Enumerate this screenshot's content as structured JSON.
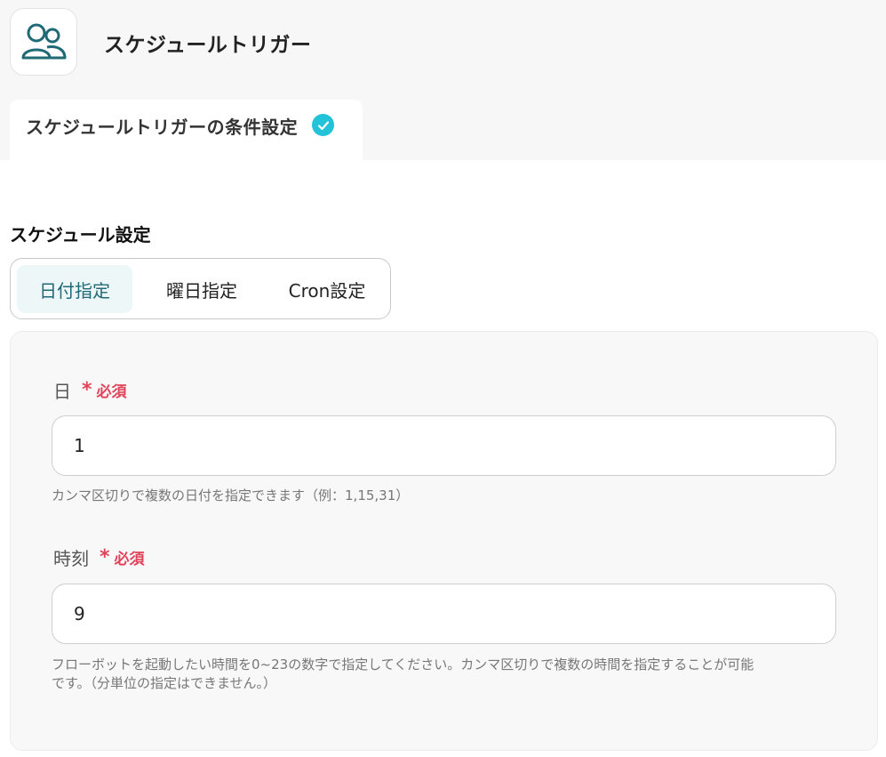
{
  "header": {
    "app_icon": "users-icon",
    "title": "スケジュールトリガー"
  },
  "tabs": [
    {
      "label": "スケジュールトリガーの条件設定",
      "status_icon": "check-circle-icon",
      "active": true
    }
  ],
  "schedule": {
    "section_title": "スケジュール設定",
    "modes": [
      {
        "label": "日付指定",
        "selected": true
      },
      {
        "label": "曜日指定",
        "selected": false
      },
      {
        "label": "Cron設定",
        "selected": false
      }
    ]
  },
  "fields": {
    "day": {
      "label": "日",
      "required_mark": "*",
      "required_text": "必須",
      "value": "1",
      "help": "カンマ区切りで複数の日付を指定できます（例：1,15,31）"
    },
    "time": {
      "label": "時刻",
      "required_mark": "*",
      "required_text": "必須",
      "value": "9",
      "help_line1": "フローボットを起動したい時間を0~23の数字で指定してください。カンマ区切りで複数の時間を指定することが可能",
      "help_line2": "です。（分単位の指定はできません。）"
    }
  },
  "colors": {
    "accent_teal": "#1f6a76",
    "check_cyan": "#22c3d8",
    "required_red": "#e0445a"
  }
}
